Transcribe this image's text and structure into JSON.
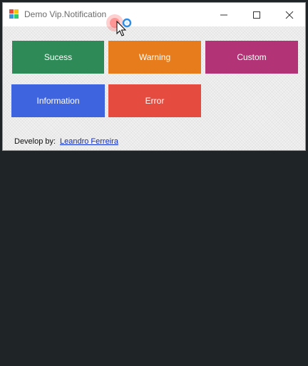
{
  "window": {
    "title": "Demo Vip.Notification",
    "app_icon": "windows-form-icon",
    "controls": {
      "minimize": "minimize-icon",
      "maximize": "maximize-icon",
      "close": "close-icon"
    }
  },
  "buttons": [
    {
      "label": "Sucess",
      "color": "#2e8a56"
    },
    {
      "label": "Warning",
      "color": "#e67c1b"
    },
    {
      "label": "Custom",
      "color": "#b23376"
    },
    {
      "label": "Information",
      "color": "#3f64e0"
    },
    {
      "label": "Error",
      "color": "#e54b3f"
    }
  ],
  "footer": {
    "label": "Develop by:",
    "link_text": "Leandro Ferreira"
  },
  "colors": {
    "desktop": "#1f2426",
    "window_bg": "#f1f1f1",
    "link": "#0a2bd6"
  },
  "cursor": {
    "icon": "arrow-busy-cursor-icon"
  }
}
